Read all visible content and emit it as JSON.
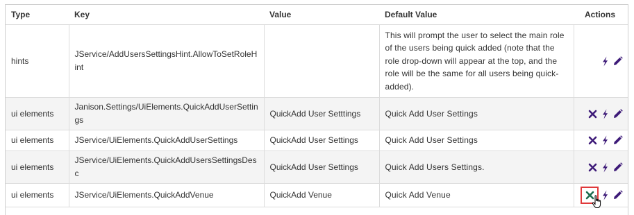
{
  "columns": {
    "type": "Type",
    "key": "Key",
    "value": "Value",
    "default": "Default Value",
    "actions": "Actions"
  },
  "rows": [
    {
      "type": "hints",
      "key": "JService/AddUsersSettingsHint.AllowToSetRoleHint",
      "value": "",
      "default": "This will prompt the user to select the main role of the users being quick added (note that the role drop-down will appear at the top, and the role will be the same for all users being quick-added).",
      "has_delete": false
    },
    {
      "type": "ui elements",
      "key": "Janison.Settings/UiElements.QuickAddUserSettings",
      "value": "QuickAdd User Setttings",
      "default": "Quick Add User Settings",
      "has_delete": true
    },
    {
      "type": "ui elements",
      "key": "JService/UiElements.QuickAddUserSettings",
      "value": "QuickAdd User Settings",
      "default": "Quick Add User Settings",
      "has_delete": true
    },
    {
      "type": "ui elements",
      "key": "JService/UiElements.QuickAddUsersSettingsDesc",
      "value": "QuickAdd User Settings",
      "default": "Quick Add Users Settings.",
      "has_delete": true
    },
    {
      "type": "ui elements",
      "key": "JService/UiElements.QuickAddVenue",
      "value": "QuickAdd Venue",
      "default": "Quick Add Venue",
      "has_delete": true,
      "delete_highlighted": true
    }
  ],
  "icons": {
    "delete": "close-icon",
    "quick": "lightning-icon",
    "edit": "pencil-icon",
    "cursor": "hand-pointer-cursor"
  },
  "colors": {
    "icon_purple": "#3d1a78",
    "delete_highlighted": "#1e6b4f",
    "highlight_border": "#e0393b",
    "row_shade": "#f4f4f4"
  }
}
